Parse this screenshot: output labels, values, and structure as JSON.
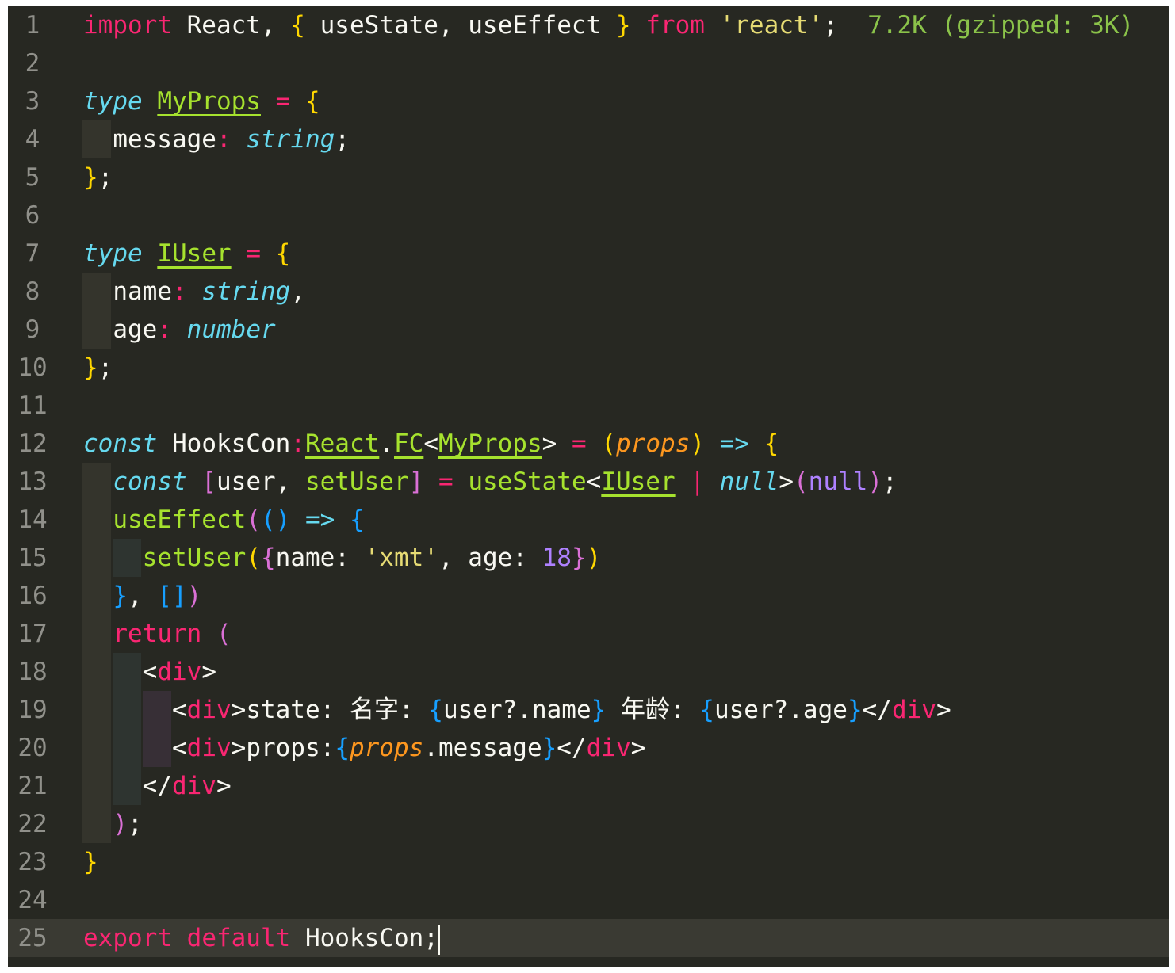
{
  "editor": {
    "language": "tsx",
    "cursor": {
      "line": 25,
      "column": 25
    },
    "colors": {
      "background": "#272822",
      "keyword": "#f92672",
      "storage": "#66d9ef",
      "type": "#a6e22e",
      "string": "#e6db74",
      "number": "#ae81ff",
      "parameter": "#fd971f",
      "import_cost": "#8bc34a"
    },
    "lines": [
      {
        "num": "1",
        "tokens": [
          {
            "t": "import",
            "c": "kw"
          },
          {
            "t": " React, "
          },
          {
            "t": "{",
            "c": "br1"
          },
          {
            "t": " useState, useEffect "
          },
          {
            "t": "}",
            "c": "br1"
          },
          {
            "t": " "
          },
          {
            "t": "from",
            "c": "kw"
          },
          {
            "t": " "
          },
          {
            "t": "'react'",
            "c": "str"
          },
          {
            "t": ";  "
          },
          {
            "t": "7.2K (gzipped: 3K)",
            "c": "cm"
          }
        ]
      },
      {
        "num": "2",
        "tokens": []
      },
      {
        "num": "3",
        "tokens": [
          {
            "t": "type",
            "c": "st"
          },
          {
            "t": " "
          },
          {
            "t": "MyProps",
            "c": "tp"
          },
          {
            "t": " "
          },
          {
            "t": "=",
            "c": "op"
          },
          {
            "t": " "
          },
          {
            "t": "{",
            "c": "br1"
          }
        ]
      },
      {
        "num": "4",
        "indent": 1,
        "tokens": [
          {
            "t": "  message"
          },
          {
            "t": ":",
            "c": "op"
          },
          {
            "t": " "
          },
          {
            "t": "string",
            "c": "st"
          },
          {
            "t": ";"
          }
        ]
      },
      {
        "num": "5",
        "tokens": [
          {
            "t": "}",
            "c": "br1"
          },
          {
            "t": ";"
          }
        ]
      },
      {
        "num": "6",
        "tokens": []
      },
      {
        "num": "7",
        "tokens": [
          {
            "t": "type",
            "c": "st"
          },
          {
            "t": " "
          },
          {
            "t": "IUser",
            "c": "tp"
          },
          {
            "t": " "
          },
          {
            "t": "=",
            "c": "op"
          },
          {
            "t": " "
          },
          {
            "t": "{",
            "c": "br1"
          }
        ]
      },
      {
        "num": "8",
        "indent": 1,
        "tokens": [
          {
            "t": "  name"
          },
          {
            "t": ":",
            "c": "op"
          },
          {
            "t": " "
          },
          {
            "t": "string",
            "c": "st"
          },
          {
            "t": ","
          }
        ]
      },
      {
        "num": "9",
        "indent": 1,
        "tokens": [
          {
            "t": "  age"
          },
          {
            "t": ":",
            "c": "op"
          },
          {
            "t": " "
          },
          {
            "t": "number",
            "c": "st"
          }
        ]
      },
      {
        "num": "10",
        "tokens": [
          {
            "t": "}",
            "c": "br1"
          },
          {
            "t": ";"
          }
        ]
      },
      {
        "num": "11",
        "tokens": []
      },
      {
        "num": "12",
        "tokens": [
          {
            "t": "const",
            "c": "st"
          },
          {
            "t": " HooksCon"
          },
          {
            "t": ":",
            "c": "op"
          },
          {
            "t": "React",
            "c": "tp"
          },
          {
            "t": "."
          },
          {
            "t": "FC",
            "c": "tp"
          },
          {
            "t": "<"
          },
          {
            "t": "MyProps",
            "c": "tp"
          },
          {
            "t": ">"
          },
          {
            "t": " "
          },
          {
            "t": "=",
            "c": "op"
          },
          {
            "t": " "
          },
          {
            "t": "(",
            "c": "br1"
          },
          {
            "t": "props",
            "c": "pa"
          },
          {
            "t": ")",
            "c": "br1"
          },
          {
            "t": " "
          },
          {
            "t": "=>",
            "c": "st"
          },
          {
            "t": " "
          },
          {
            "t": "{",
            "c": "br1"
          }
        ]
      },
      {
        "num": "13",
        "indent": 1,
        "tokens": [
          {
            "t": "  "
          },
          {
            "t": "const",
            "c": "st"
          },
          {
            "t": " "
          },
          {
            "t": "[",
            "c": "br2"
          },
          {
            "t": "user, "
          },
          {
            "t": "setUser",
            "c": "fn"
          },
          {
            "t": "]",
            "c": "br2"
          },
          {
            "t": " "
          },
          {
            "t": "=",
            "c": "op"
          },
          {
            "t": " "
          },
          {
            "t": "useState",
            "c": "fn"
          },
          {
            "t": "<"
          },
          {
            "t": "IUser",
            "c": "tp"
          },
          {
            "t": " "
          },
          {
            "t": "|",
            "c": "op"
          },
          {
            "t": " "
          },
          {
            "t": "null",
            "c": "st"
          },
          {
            "t": ">"
          },
          {
            "t": "(",
            "c": "br2"
          },
          {
            "t": "null",
            "c": "num"
          },
          {
            "t": ")",
            "c": "br2"
          },
          {
            "t": ";"
          }
        ]
      },
      {
        "num": "14",
        "indent": 1,
        "tokens": [
          {
            "t": "  "
          },
          {
            "t": "useEffect",
            "c": "fn"
          },
          {
            "t": "(",
            "c": "br2"
          },
          {
            "t": "()",
            "c": "br3"
          },
          {
            "t": " "
          },
          {
            "t": "=>",
            "c": "st"
          },
          {
            "t": " "
          },
          {
            "t": "{",
            "c": "br3"
          }
        ]
      },
      {
        "num": "15",
        "indent": 2,
        "tokens": [
          {
            "t": "    "
          },
          {
            "t": "setUser",
            "c": "fn"
          },
          {
            "t": "(",
            "c": "br1"
          },
          {
            "t": "{",
            "c": "br2"
          },
          {
            "t": "name: "
          },
          {
            "t": "'xmt'",
            "c": "str"
          },
          {
            "t": ", age: "
          },
          {
            "t": "18",
            "c": "num"
          },
          {
            "t": "}",
            "c": "br2"
          },
          {
            "t": ")",
            "c": "br1"
          }
        ]
      },
      {
        "num": "16",
        "indent": 1,
        "tokens": [
          {
            "t": "  "
          },
          {
            "t": "}",
            "c": "br3"
          },
          {
            "t": ", "
          },
          {
            "t": "[]",
            "c": "br3"
          },
          {
            "t": ")",
            "c": "br2"
          }
        ]
      },
      {
        "num": "17",
        "indent": 1,
        "tokens": [
          {
            "t": "  "
          },
          {
            "t": "return",
            "c": "kw"
          },
          {
            "t": " "
          },
          {
            "t": "(",
            "c": "br2"
          }
        ]
      },
      {
        "num": "18",
        "indent": 2,
        "tokens": [
          {
            "t": "    <"
          },
          {
            "t": "div",
            "c": "kw"
          },
          {
            "t": ">"
          }
        ]
      },
      {
        "num": "19",
        "indent": 3,
        "tokens": [
          {
            "t": "      <"
          },
          {
            "t": "div",
            "c": "kw"
          },
          {
            "t": ">state: 名字: "
          },
          {
            "t": "{",
            "c": "br3"
          },
          {
            "t": "user?.name"
          },
          {
            "t": "}",
            "c": "br3"
          },
          {
            "t": " 年龄: "
          },
          {
            "t": "{",
            "c": "br3"
          },
          {
            "t": "user?.age"
          },
          {
            "t": "}",
            "c": "br3"
          },
          {
            "t": "</"
          },
          {
            "t": "div",
            "c": "kw"
          },
          {
            "t": ">"
          }
        ]
      },
      {
        "num": "20",
        "indent": 3,
        "tokens": [
          {
            "t": "      <"
          },
          {
            "t": "div",
            "c": "kw"
          },
          {
            "t": ">props:"
          },
          {
            "t": "{",
            "c": "br3"
          },
          {
            "t": "props",
            "c": "pa"
          },
          {
            "t": ".message"
          },
          {
            "t": "}",
            "c": "br3"
          },
          {
            "t": "</"
          },
          {
            "t": "div",
            "c": "kw"
          },
          {
            "t": ">"
          }
        ]
      },
      {
        "num": "21",
        "indent": 2,
        "tokens": [
          {
            "t": "    </"
          },
          {
            "t": "div",
            "c": "kw"
          },
          {
            "t": ">"
          }
        ]
      },
      {
        "num": "22",
        "indent": 1,
        "tokens": [
          {
            "t": "  "
          },
          {
            "t": ")",
            "c": "br2"
          },
          {
            "t": ";"
          }
        ]
      },
      {
        "num": "23",
        "tokens": [
          {
            "t": "}",
            "c": "br1"
          }
        ]
      },
      {
        "num": "24",
        "tokens": []
      },
      {
        "num": "25",
        "current": true,
        "tokens": [
          {
            "t": "export",
            "c": "kw"
          },
          {
            "t": " "
          },
          {
            "t": "default",
            "c": "kw"
          },
          {
            "t": " HooksCon;"
          }
        ]
      }
    ]
  }
}
